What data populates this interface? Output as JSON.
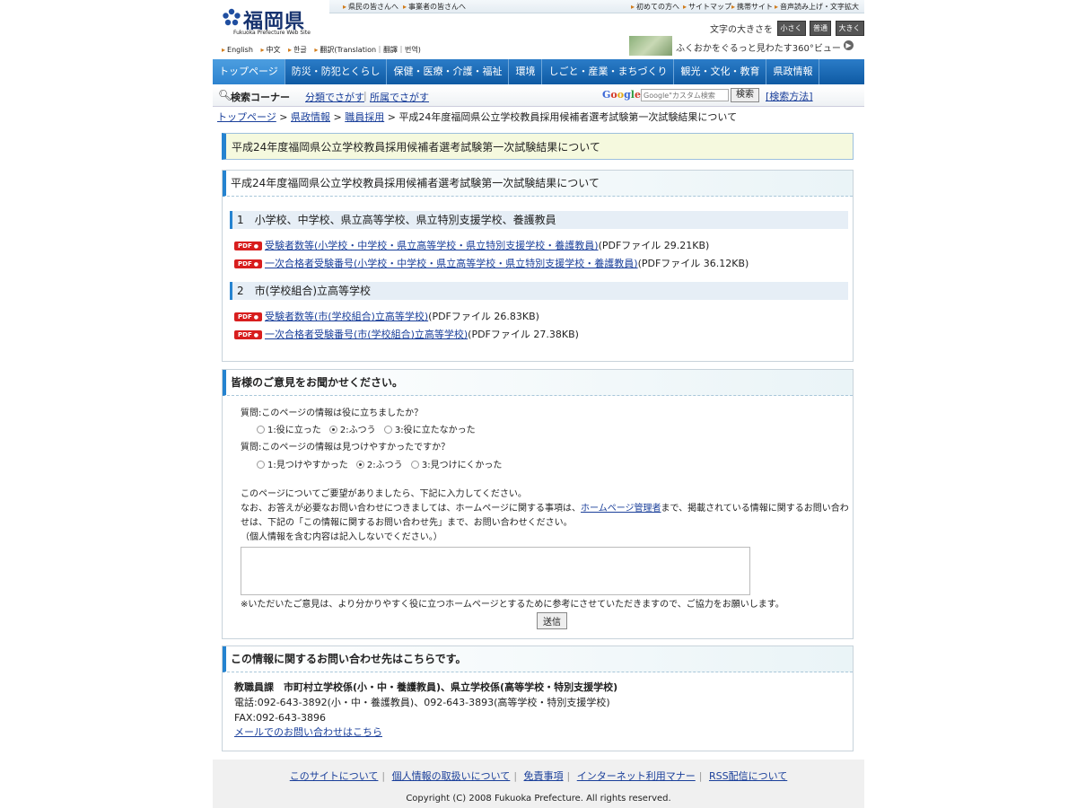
{
  "header": {
    "logo_text": "福岡県",
    "logo_sub": "Fukuoka Prefecture Web Site",
    "top_links_left": [
      "県民の皆さんへ",
      "事業者の皆さんへ"
    ],
    "top_links_right": [
      "初めての方へ",
      "サイトマップ",
      "携帯サイト",
      "音声読み上げ・文字拡大"
    ],
    "languages": [
      "English",
      "中文",
      "한글",
      "翻訳(Translation｜翻譯｜번역)"
    ],
    "text_size_label": "文字の大きさを",
    "text_sizes": [
      "小さく",
      "普通",
      "大きく"
    ],
    "banner_text": "ふくおかをぐるっと見わたす360°ビュー"
  },
  "nav": [
    "トップページ",
    "防災・防犯とくらし",
    "保健・医療・介護・福祉",
    "環境",
    "しごと・産業・まちづくり",
    "観光・文化・教育",
    "県政情報"
  ],
  "search": {
    "label": "検索コーナー",
    "link1": "分類でさがす",
    "link2": "所属でさがす",
    "placeholder": "Google\"カスタム検索",
    "button": "検索",
    "advanced": "[検索方法]"
  },
  "breadcrumb": {
    "items": [
      "トップページ",
      "県政情報",
      "職員採用"
    ],
    "current": "平成24年度福岡県公立学校教員採用候補者選考試験第一次試験結果について"
  },
  "page_title": "平成24年度福岡県公立学校教員採用候補者選考試験第一次試験結果について",
  "content": {
    "heading": "平成24年度福岡県公立学校教員採用候補者選考試験第一次試験結果について",
    "sections": [
      {
        "title": "1　小学校、中学校、県立高等学校、県立特別支援学校、養護教員",
        "files": [
          {
            "link": "受験者数等(小学校・中学校・県立高等学校・県立特別支援学校・養護教員)",
            "info": "(PDFファイル 29.21KB)"
          },
          {
            "link": "一次合格者受験番号(小学校・中学校・県立高等学校・県立特別支援学校・養護教員)",
            "info": "(PDFファイル 36.12KB)"
          }
        ]
      },
      {
        "title": "2　市(学校組合)立高等学校",
        "files": [
          {
            "link": "受験者数等(市(学校組合)立高等学校)",
            "info": "(PDFファイル 26.83KB)"
          },
          {
            "link": "一次合格者受験番号(市(学校組合)立高等学校)",
            "info": "(PDFファイル 27.38KB)"
          }
        ]
      }
    ],
    "pdf_badge": "PDF"
  },
  "feedback": {
    "heading": "皆様のご意見をお聞かせください。",
    "q1": "質問:このページの情報は役に立ちましたか？",
    "q1_options": [
      "1:役に立った",
      "2:ふつう",
      "3:役に立たなかった"
    ],
    "q2": "質問:このページの情報は見つけやすかったですか？",
    "q2_options": [
      "1:見つけやすかった",
      "2:ふつう",
      "3:見つけにくかった"
    ],
    "text1": "このページについてご要望がありましたら、下記に入力してください。",
    "text2a": "なお、お答えが必要なお問い合わせにつきましては、ホームページに関する事項は、",
    "text2_link": "ホームページ管理者",
    "text2b": "まで、掲載されている情報に関するお問い合わせは、下記の「この情報に関するお問い合わせ先」まで、お問い合わせください。",
    "text3": "（個人情報を含む内容は記入しないでください。）",
    "note": "※いただいたご意見は、より分かりやすく役に立つホームページとするために参考にさせていただきますので、ご協力をお願いします。",
    "submit": "送信"
  },
  "contact": {
    "heading": "この情報に関するお問い合わせ先はこちらです。",
    "dept": "教職員課　市町村立学校係(小・中・養護教員)、県立学校係(高等学校・特別支援学校)",
    "phone": "電話:092-643-3892(小・中・養護教員)、092-643-3893(高等学校・特別支援学校)",
    "fax": "FAX:092-643-3896",
    "mail_link": "メールでのお問い合わせはこちら"
  },
  "footer": {
    "links": [
      "このサイトについて",
      "個人情報の取扱いについて",
      "免責事項",
      "インターネット利用マナー",
      "RSS配信について"
    ],
    "copyright": "Copyright (C) 2008 Fukuoka Prefecture. All rights reserved."
  }
}
